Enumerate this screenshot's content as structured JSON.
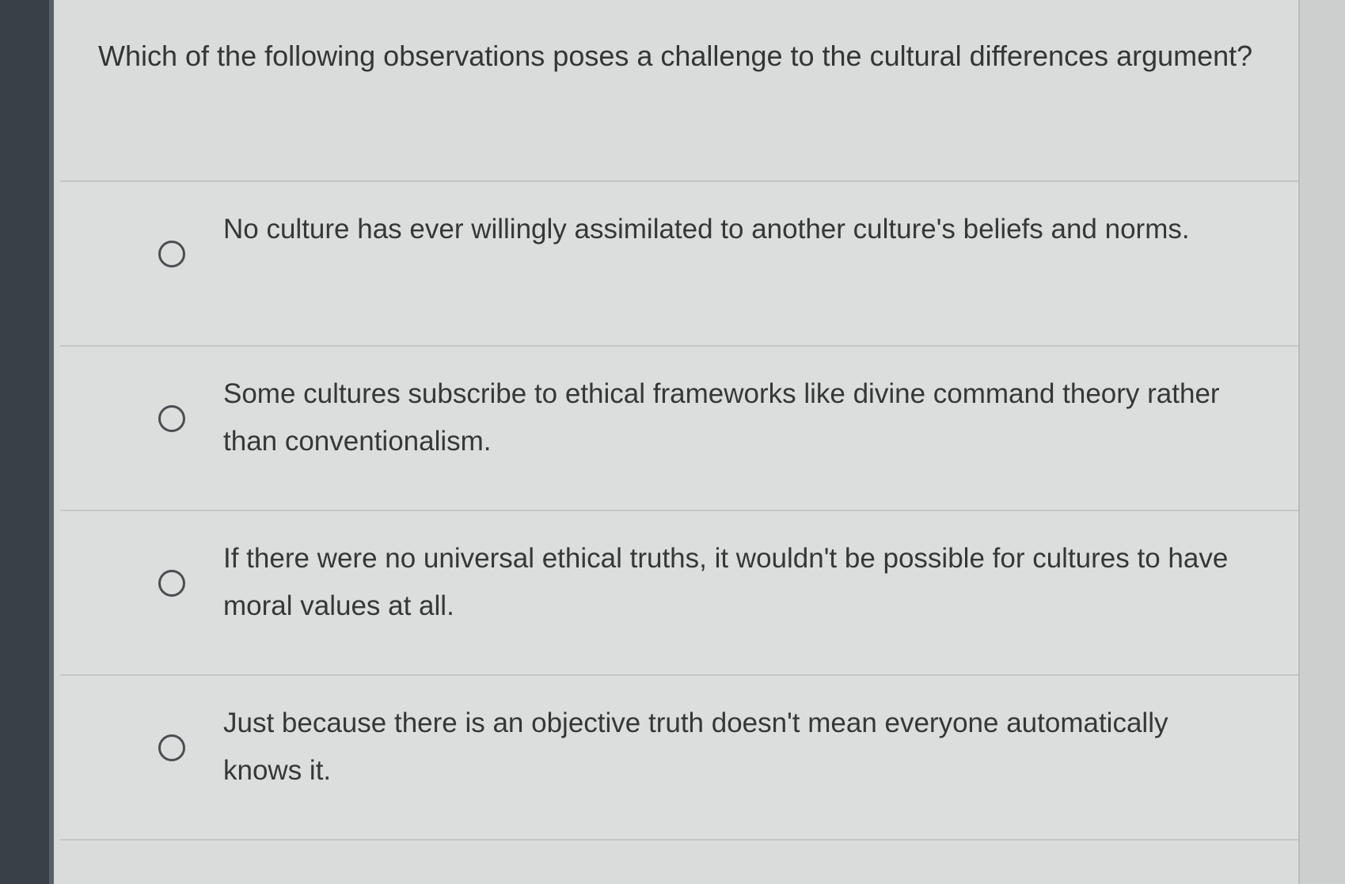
{
  "question": {
    "text": "Which of the following observations poses a challenge to the cultural differences argument?"
  },
  "options": [
    {
      "label": "No culture has ever willingly assimilated to another culture's beliefs and norms.",
      "selected": false
    },
    {
      "label": "Some cultures subscribe to ethical frameworks like divine command theory rather than conventionalism.",
      "selected": false
    },
    {
      "label": "If there were no universal ethical truths, it wouldn't be possible for cultures to have moral values at all.",
      "selected": false
    },
    {
      "label": "Just because there is an objective truth doesn't mean everyone automatically knows it.",
      "selected": false
    }
  ],
  "colors": {
    "sidebar": "#3a4048",
    "panel_background": "#dadcdb",
    "text": "#333536",
    "radio_border": "#4a4e52"
  }
}
